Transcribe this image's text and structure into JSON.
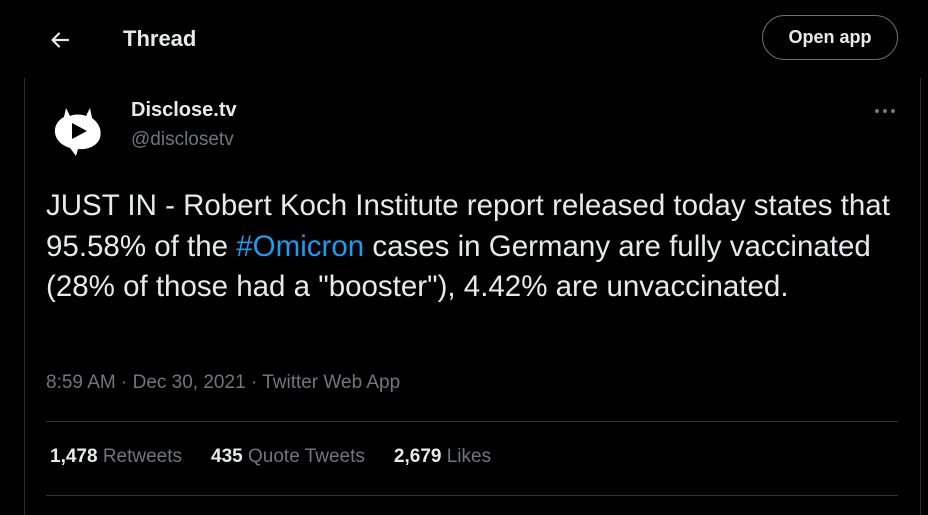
{
  "header": {
    "back_icon": "arrow-left-icon",
    "title": "Thread",
    "open_app_label": "Open app"
  },
  "tweet": {
    "author_name": "Disclose.tv",
    "author_handle": "@disclosetv",
    "avatar_icon": "disclose-tv-logo",
    "more_icon": "more-horizontal-icon",
    "text_before": "JUST IN - Robert Koch Institute report released today states that 95.58% of the ",
    "hashtag": "#Omicron",
    "text_after": " cases in Germany are fully vaccinated (28% of those had a \"booster\"), 4.42% are unvaccinated.",
    "time": "8:59 AM",
    "separator": "·",
    "date": "Dec 30, 2021",
    "source": "Twitter Web App",
    "stats": {
      "retweets_count": "1,478",
      "retweets_label": "Retweets",
      "quotes_count": "435",
      "quotes_label": "Quote Tweets",
      "likes_count": "2,679",
      "likes_label": "Likes"
    }
  },
  "colors": {
    "background": "#000000",
    "text": "#e7e9ea",
    "secondary": "#71767b",
    "accent": "#1d9bf0",
    "divider": "#2f3336"
  }
}
